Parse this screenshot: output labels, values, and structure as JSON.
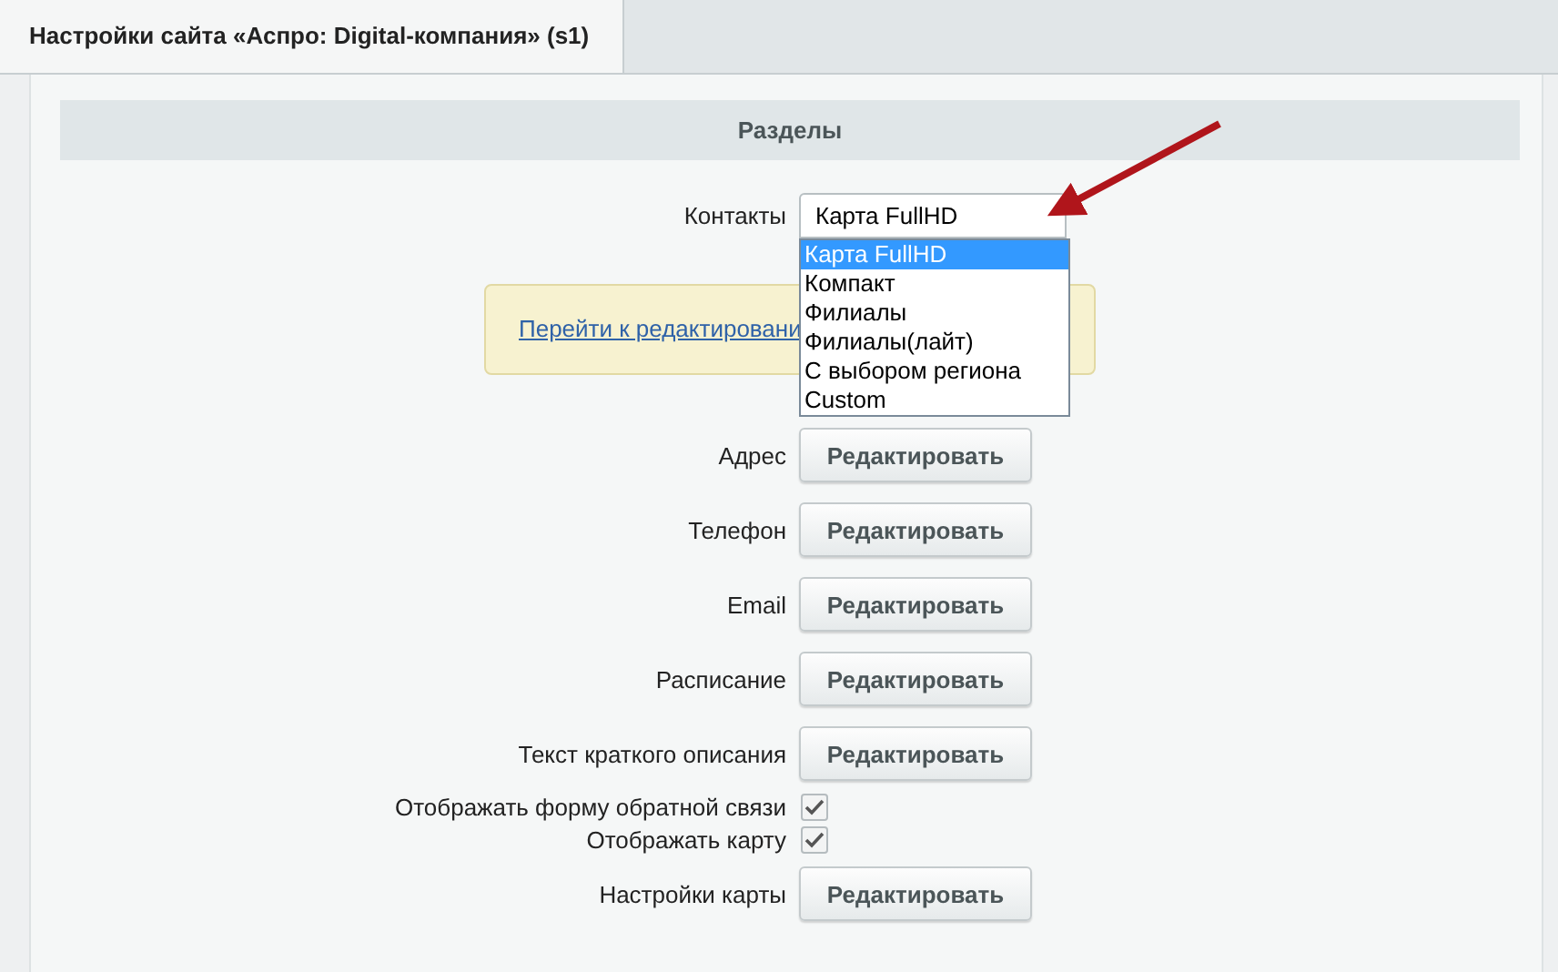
{
  "tabs": [
    {
      "label": "Настройки сайта «Аспро: Digital-компания» (s1)",
      "selected": true
    }
  ],
  "section": {
    "title": "Разделы"
  },
  "contacts": {
    "label": "Контакты",
    "value": "Карта FullHD",
    "expanded": true,
    "options": [
      {
        "label": "Карта FullHD",
        "selected": true
      },
      {
        "label": "Компакт",
        "selected": false
      },
      {
        "label": "Филиалы",
        "selected": false
      },
      {
        "label": "Филиалы(лайт)",
        "selected": false
      },
      {
        "label": "С выбором региона",
        "selected": false
      },
      {
        "label": "Custom",
        "selected": false
      }
    ]
  },
  "notice": {
    "link": "Перейти к редактировани"
  },
  "rows": [
    {
      "kind": "button",
      "label": "Адрес",
      "button": "Редактировать"
    },
    {
      "kind": "button",
      "label": "Телефон",
      "button": "Редактировать"
    },
    {
      "kind": "button",
      "label": "Email",
      "button": "Редактировать"
    },
    {
      "kind": "button",
      "label": "Расписание",
      "button": "Редактировать"
    },
    {
      "kind": "button",
      "label": "Текст краткого описания",
      "button": "Редактировать"
    },
    {
      "kind": "checkbox",
      "label": "Отображать форму обратной связи",
      "checked": true
    },
    {
      "kind": "checkbox",
      "label": "Отображать карту",
      "checked": true
    },
    {
      "kind": "button",
      "label": "Настройки карты",
      "button": "Редактировать"
    }
  ]
}
